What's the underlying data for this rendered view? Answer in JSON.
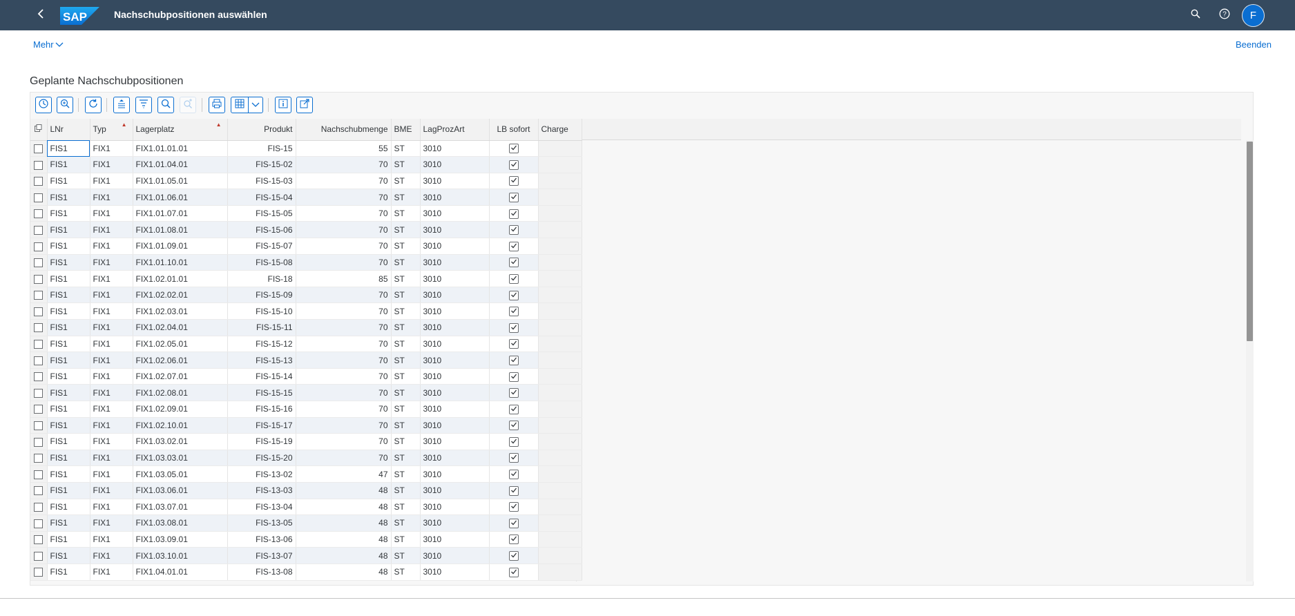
{
  "shell": {
    "title": "Nachschubpositionen auswählen",
    "logo_text": "SAP",
    "avatar_initial": "F",
    "icons": [
      "back-icon",
      "search-icon",
      "help-icon"
    ]
  },
  "actions": {
    "more_label": "Mehr",
    "exit_label": "Beenden"
  },
  "section_title": "Geplante Nachschubpositionen",
  "toolbar": {
    "buttons": [
      "history-icon",
      "zoom-details-icon",
      "refresh-icon",
      "sort-ascending-icon",
      "filter-icon",
      "find-icon",
      "find-next-icon",
      "print-icon",
      "layout-icon",
      "dropdown-chevron-icon",
      "info-icon",
      "export-icon"
    ]
  },
  "columns": [
    "LNr",
    "Typ",
    "Lagerplatz",
    "Produkt",
    "Nachschubmenge",
    "BME",
    "LagProzArt",
    "LB sofort",
    "Charge"
  ],
  "rows": [
    {
      "lnr": "FIS1",
      "typ": "FIX1",
      "platz": "FIX1.01.01.01",
      "produkt": "FIS-15",
      "menge": "55",
      "bme": "ST",
      "art": "3010"
    },
    {
      "lnr": "FIS1",
      "typ": "FIX1",
      "platz": "FIX1.01.04.01",
      "produkt": "FIS-15-02",
      "menge": "70",
      "bme": "ST",
      "art": "3010"
    },
    {
      "lnr": "FIS1",
      "typ": "FIX1",
      "platz": "FIX1.01.05.01",
      "produkt": "FIS-15-03",
      "menge": "70",
      "bme": "ST",
      "art": "3010"
    },
    {
      "lnr": "FIS1",
      "typ": "FIX1",
      "platz": "FIX1.01.06.01",
      "produkt": "FIS-15-04",
      "menge": "70",
      "bme": "ST",
      "art": "3010"
    },
    {
      "lnr": "FIS1",
      "typ": "FIX1",
      "platz": "FIX1.01.07.01",
      "produkt": "FIS-15-05",
      "menge": "70",
      "bme": "ST",
      "art": "3010"
    },
    {
      "lnr": "FIS1",
      "typ": "FIX1",
      "platz": "FIX1.01.08.01",
      "produkt": "FIS-15-06",
      "menge": "70",
      "bme": "ST",
      "art": "3010"
    },
    {
      "lnr": "FIS1",
      "typ": "FIX1",
      "platz": "FIX1.01.09.01",
      "produkt": "FIS-15-07",
      "menge": "70",
      "bme": "ST",
      "art": "3010"
    },
    {
      "lnr": "FIS1",
      "typ": "FIX1",
      "platz": "FIX1.01.10.01",
      "produkt": "FIS-15-08",
      "menge": "70",
      "bme": "ST",
      "art": "3010"
    },
    {
      "lnr": "FIS1",
      "typ": "FIX1",
      "platz": "FIX1.02.01.01",
      "produkt": "FIS-18",
      "menge": "85",
      "bme": "ST",
      "art": "3010"
    },
    {
      "lnr": "FIS1",
      "typ": "FIX1",
      "platz": "FIX1.02.02.01",
      "produkt": "FIS-15-09",
      "menge": "70",
      "bme": "ST",
      "art": "3010"
    },
    {
      "lnr": "FIS1",
      "typ": "FIX1",
      "platz": "FIX1.02.03.01",
      "produkt": "FIS-15-10",
      "menge": "70",
      "bme": "ST",
      "art": "3010"
    },
    {
      "lnr": "FIS1",
      "typ": "FIX1",
      "platz": "FIX1.02.04.01",
      "produkt": "FIS-15-11",
      "menge": "70",
      "bme": "ST",
      "art": "3010"
    },
    {
      "lnr": "FIS1",
      "typ": "FIX1",
      "platz": "FIX1.02.05.01",
      "produkt": "FIS-15-12",
      "menge": "70",
      "bme": "ST",
      "art": "3010"
    },
    {
      "lnr": "FIS1",
      "typ": "FIX1",
      "platz": "FIX1.02.06.01",
      "produkt": "FIS-15-13",
      "menge": "70",
      "bme": "ST",
      "art": "3010"
    },
    {
      "lnr": "FIS1",
      "typ": "FIX1",
      "platz": "FIX1.02.07.01",
      "produkt": "FIS-15-14",
      "menge": "70",
      "bme": "ST",
      "art": "3010"
    },
    {
      "lnr": "FIS1",
      "typ": "FIX1",
      "platz": "FIX1.02.08.01",
      "produkt": "FIS-15-15",
      "menge": "70",
      "bme": "ST",
      "art": "3010"
    },
    {
      "lnr": "FIS1",
      "typ": "FIX1",
      "platz": "FIX1.02.09.01",
      "produkt": "FIS-15-16",
      "menge": "70",
      "bme": "ST",
      "art": "3010"
    },
    {
      "lnr": "FIS1",
      "typ": "FIX1",
      "platz": "FIX1.02.10.01",
      "produkt": "FIS-15-17",
      "menge": "70",
      "bme": "ST",
      "art": "3010"
    },
    {
      "lnr": "FIS1",
      "typ": "FIX1",
      "platz": "FIX1.03.02.01",
      "produkt": "FIS-15-19",
      "menge": "70",
      "bme": "ST",
      "art": "3010"
    },
    {
      "lnr": "FIS1",
      "typ": "FIX1",
      "platz": "FIX1.03.03.01",
      "produkt": "FIS-15-20",
      "menge": "70",
      "bme": "ST",
      "art": "3010"
    },
    {
      "lnr": "FIS1",
      "typ": "FIX1",
      "platz": "FIX1.03.05.01",
      "produkt": "FIS-13-02",
      "menge": "47",
      "bme": "ST",
      "art": "3010"
    },
    {
      "lnr": "FIS1",
      "typ": "FIX1",
      "platz": "FIX1.03.06.01",
      "produkt": "FIS-13-03",
      "menge": "48",
      "bme": "ST",
      "art": "3010"
    },
    {
      "lnr": "FIS1",
      "typ": "FIX1",
      "platz": "FIX1.03.07.01",
      "produkt": "FIS-13-04",
      "menge": "48",
      "bme": "ST",
      "art": "3010"
    },
    {
      "lnr": "FIS1",
      "typ": "FIX1",
      "platz": "FIX1.03.08.01",
      "produkt": "FIS-13-05",
      "menge": "48",
      "bme": "ST",
      "art": "3010"
    },
    {
      "lnr": "FIS1",
      "typ": "FIX1",
      "platz": "FIX1.03.09.01",
      "produkt": "FIS-13-06",
      "menge": "48",
      "bme": "ST",
      "art": "3010"
    },
    {
      "lnr": "FIS1",
      "typ": "FIX1",
      "platz": "FIX1.03.10.01",
      "produkt": "FIS-13-07",
      "menge": "48",
      "bme": "ST",
      "art": "3010"
    },
    {
      "lnr": "FIS1",
      "typ": "FIX1",
      "platz": "FIX1.04.01.01",
      "produkt": "FIS-13-08",
      "menge": "48",
      "bme": "ST",
      "art": "3010"
    }
  ],
  "colors": {
    "shell_bg": "#354a5f",
    "accent": "#0a6ed1",
    "row_alt": "#eef2f7"
  }
}
